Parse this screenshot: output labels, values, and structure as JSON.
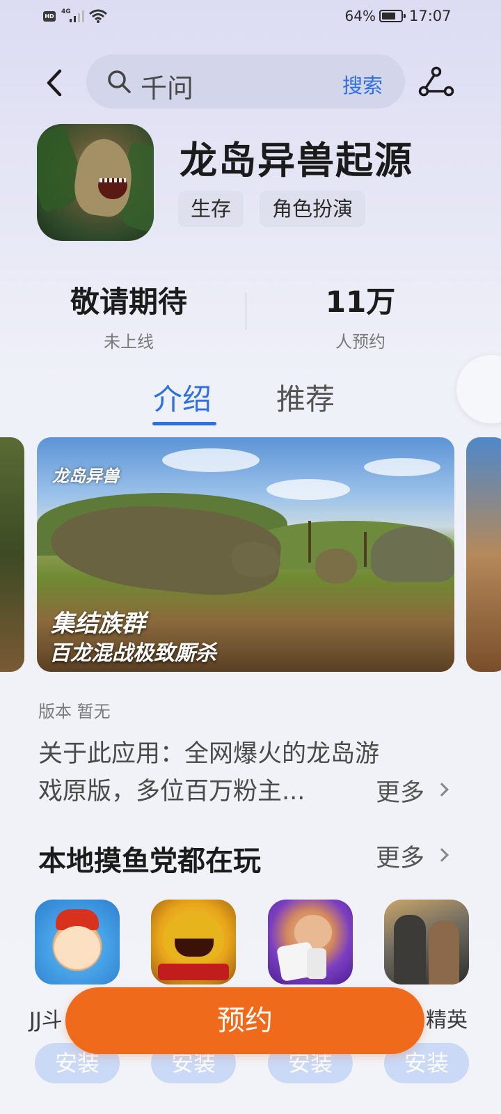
{
  "status_bar": {
    "hd": "HD",
    "network": "4G",
    "battery_percent": "64%",
    "time": "17:07"
  },
  "search": {
    "query": "千问",
    "button_label": "搜索"
  },
  "app": {
    "title": "龙岛异兽起源",
    "tags": [
      "生存",
      "角色扮演"
    ]
  },
  "stats": [
    {
      "value": "敬请期待",
      "label": "未上线"
    },
    {
      "value": "11万",
      "label": "人预约"
    }
  ],
  "tabs": [
    {
      "label": "介绍",
      "active": true
    },
    {
      "label": "推荐",
      "active": false
    }
  ],
  "screenshot": {
    "logo_text": "龙岛异兽",
    "caption_1": "集结族群",
    "caption_2": "百龙混战极致厮杀"
  },
  "description": {
    "version": "版本 暂无",
    "line_1": "关于此应用：全网爆火的龙岛游",
    "line_2": "戏原版，多位百万粉主...",
    "more_label": "更多"
  },
  "recommend_section": {
    "title": "本地摸鱼党都在玩",
    "more_label": "更多",
    "apps": [
      {
        "name": "JJ斗",
        "install_label": "安装",
        "icon": "cartoon-boss-icon"
      },
      {
        "name": "",
        "install_label": "安装",
        "icon": "golden-shark-icon"
      },
      {
        "name": "",
        "install_label": "安装",
        "icon": "dice-game-icon"
      },
      {
        "name": "精英",
        "install_label": "安装",
        "icon": "shooter-game-icon"
      }
    ]
  },
  "reserve_button": "预约",
  "colors": {
    "accent_blue": "#2f6fe0",
    "reserve_orange": "#f06a1c",
    "install_disabled": "#c9d9f6"
  }
}
